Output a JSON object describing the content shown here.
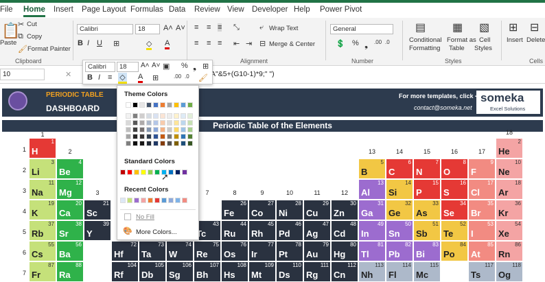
{
  "ribbon_tabs": [
    "File",
    "Home",
    "Insert",
    "Page Layout",
    "Formulas",
    "Data",
    "Review",
    "View",
    "Developer",
    "Help",
    "Power Pivot"
  ],
  "clipboard": {
    "paste": "Paste",
    "cut": "Cut",
    "copy": "Copy",
    "painter": "Format Painter",
    "label": "Clipboard"
  },
  "font": {
    "name": "Calibri",
    "size": "18"
  },
  "alignment": {
    "wrap": "Wrap Text",
    "merge": "Merge & Center",
    "label": "Alignment"
  },
  "number": {
    "format": "General",
    "label": "Number"
  },
  "styles": {
    "cond": "Conditional",
    "cond2": "Formatting",
    "table": "Format as",
    "table2": "Table",
    "cell": "Cell",
    "cell2": "Styles",
    "label": "Styles"
  },
  "cells": {
    "insert": "Insert",
    "delete": "Delete",
    "label": "Cells"
  },
  "formula_bar": {
    "name_box": "10",
    "formula": "A\"&5+(G10-1)*9;\"     \")"
  },
  "mini_toolbar": {
    "font": "Calibri",
    "size": "18"
  },
  "header": {
    "brand": "PERIODIC TABLE",
    "dashboard": "DASHBOARD",
    "templates": "For more templates, click ➔",
    "contact": "contact@someka.net",
    "logo": "someka",
    "logo_sub": "Excel Solutions"
  },
  "sheet_title": "Periodic Table of the Elements",
  "palette": {
    "theme": "Theme Colors",
    "standard": "Standard Colors",
    "recent": "Recent Colors",
    "nofill": "No Fill",
    "more": "More Colors..."
  },
  "group_numbers": {
    "g1": "1",
    "g2": "2",
    "g3": "3",
    "g4": "4",
    "g7": "7",
    "g8": "8",
    "g9": "9",
    "g10": "10",
    "g11": "11",
    "g12": "12",
    "g13": "13",
    "g14": "14",
    "g15": "15",
    "g16": "16",
    "g17": "17",
    "g18": "18"
  },
  "row_numbers": [
    "1",
    "2",
    "3",
    "4",
    "5",
    "6",
    "7"
  ],
  "elements": [
    {
      "s": "H",
      "n": "1",
      "c": "#e53935"
    },
    {
      "s": "He",
      "n": "2",
      "c": "#f4a4a4"
    },
    {
      "s": "Li",
      "n": "3",
      "c": "#c5e17a"
    },
    {
      "s": "Be",
      "n": "4",
      "c": "#2fb24a"
    },
    {
      "s": "B",
      "n": "5",
      "c": "#f2c744"
    },
    {
      "s": "C",
      "n": "6",
      "c": "#e53935"
    },
    {
      "s": "N",
      "n": "7",
      "c": "#e53935"
    },
    {
      "s": "O",
      "n": "8",
      "c": "#e53935"
    },
    {
      "s": "F",
      "n": "9",
      "c": "#f28b82"
    },
    {
      "s": "Ne",
      "n": "10",
      "c": "#f4a4a4"
    },
    {
      "s": "Na",
      "n": "11",
      "c": "#c5e17a"
    },
    {
      "s": "Mg",
      "n": "12",
      "c": "#2fb24a"
    },
    {
      "s": "Al",
      "n": "13",
      "c": "#9c6ccf"
    },
    {
      "s": "Si",
      "n": "14",
      "c": "#f2c744"
    },
    {
      "s": "P",
      "n": "15",
      "c": "#e53935"
    },
    {
      "s": "S",
      "n": "16",
      "c": "#e53935"
    },
    {
      "s": "Cl",
      "n": "17",
      "c": "#f28b82"
    },
    {
      "s": "Ar",
      "n": "18",
      "c": "#f4a4a4"
    },
    {
      "s": "K",
      "n": "19",
      "c": "#c5e17a"
    },
    {
      "s": "Ca",
      "n": "20",
      "c": "#2fb24a"
    },
    {
      "s": "Sc",
      "n": "21",
      "c": "#2a3240"
    },
    {
      "s": "Fe",
      "n": "26",
      "c": "#2a3240"
    },
    {
      "s": "Co",
      "n": "27",
      "c": "#2a3240"
    },
    {
      "s": "Ni",
      "n": "28",
      "c": "#2a3240"
    },
    {
      "s": "Cu",
      "n": "29",
      "c": "#2a3240"
    },
    {
      "s": "Zn",
      "n": "30",
      "c": "#2a3240"
    },
    {
      "s": "Ga",
      "n": "31",
      "c": "#9c6ccf"
    },
    {
      "s": "Ge",
      "n": "32",
      "c": "#f2c744"
    },
    {
      "s": "As",
      "n": "33",
      "c": "#f2c744"
    },
    {
      "s": "Se",
      "n": "34",
      "c": "#e53935"
    },
    {
      "s": "Br",
      "n": "35",
      "c": "#f28b82"
    },
    {
      "s": "Kr",
      "n": "36",
      "c": "#f4a4a4"
    },
    {
      "s": "Rb",
      "n": "37",
      "c": "#c5e17a"
    },
    {
      "s": "Sr",
      "n": "38",
      "c": "#2fb24a"
    },
    {
      "s": "Y",
      "n": "39",
      "c": "#2a3240"
    },
    {
      "s": "Tc",
      "n": "43",
      "c": "#2a3240"
    },
    {
      "s": "Ru",
      "n": "44",
      "c": "#2a3240"
    },
    {
      "s": "Rh",
      "n": "45",
      "c": "#2a3240"
    },
    {
      "s": "Pd",
      "n": "46",
      "c": "#2a3240"
    },
    {
      "s": "Ag",
      "n": "47",
      "c": "#2a3240"
    },
    {
      "s": "Cd",
      "n": "48",
      "c": "#2a3240"
    },
    {
      "s": "In",
      "n": "49",
      "c": "#9c6ccf"
    },
    {
      "s": "Sn",
      "n": "50",
      "c": "#9c6ccf"
    },
    {
      "s": "Sb",
      "n": "51",
      "c": "#f2c744"
    },
    {
      "s": "Te",
      "n": "52",
      "c": "#f2c744"
    },
    {
      "s": "I",
      "n": "53",
      "c": "#f28b82"
    },
    {
      "s": "Xe",
      "n": "54",
      "c": "#f4a4a4"
    },
    {
      "s": "Cs",
      "n": "55",
      "c": "#c5e17a"
    },
    {
      "s": "Ba",
      "n": "56",
      "c": "#2fb24a"
    },
    {
      "s": "Hf",
      "n": "72",
      "c": "#2a3240"
    },
    {
      "s": "Ta",
      "n": "73",
      "c": "#2a3240"
    },
    {
      "s": "W",
      "n": "74",
      "c": "#2a3240"
    },
    {
      "s": "Re",
      "n": "75",
      "c": "#2a3240"
    },
    {
      "s": "Os",
      "n": "76",
      "c": "#2a3240"
    },
    {
      "s": "Ir",
      "n": "77",
      "c": "#2a3240"
    },
    {
      "s": "Pt",
      "n": "78",
      "c": "#2a3240"
    },
    {
      "s": "Au",
      "n": "79",
      "c": "#2a3240"
    },
    {
      "s": "Hg",
      "n": "80",
      "c": "#2a3240"
    },
    {
      "s": "Tl",
      "n": "81",
      "c": "#9c6ccf"
    },
    {
      "s": "Pb",
      "n": "82",
      "c": "#9c6ccf"
    },
    {
      "s": "Bi",
      "n": "83",
      "c": "#9c6ccf"
    },
    {
      "s": "Po",
      "n": "84",
      "c": "#f2c744"
    },
    {
      "s": "At",
      "n": "85",
      "c": "#f28b82"
    },
    {
      "s": "Rn",
      "n": "86",
      "c": "#f4a4a4"
    },
    {
      "s": "Fr",
      "n": "87",
      "c": "#c5e17a"
    },
    {
      "s": "Ra",
      "n": "88",
      "c": "#2fb24a"
    },
    {
      "s": "Rf",
      "n": "104",
      "c": "#2a3240"
    },
    {
      "s": "Db",
      "n": "105",
      "c": "#2a3240"
    },
    {
      "s": "Sg",
      "n": "106",
      "c": "#2a3240"
    },
    {
      "s": "Bh",
      "n": "107",
      "c": "#2a3240"
    },
    {
      "s": "Hs",
      "n": "108",
      "c": "#2a3240"
    },
    {
      "s": "Mt",
      "n": "109",
      "c": "#2a3240"
    },
    {
      "s": "Ds",
      "n": "110",
      "c": "#2a3240"
    },
    {
      "s": "Rg",
      "n": "111",
      "c": "#2a3240"
    },
    {
      "s": "Cn",
      "n": "112",
      "c": "#2a3240"
    },
    {
      "s": "Nh",
      "n": "113",
      "c": "#adb9ca"
    },
    {
      "s": "Fl",
      "n": "114",
      "c": "#adb9ca"
    },
    {
      "s": "Mc",
      "n": "115",
      "c": "#adb9ca"
    },
    {
      "s": "Ts",
      "n": "117",
      "c": "#adb9ca"
    },
    {
      "s": "Og",
      "n": "118",
      "c": "#adb9ca"
    }
  ]
}
